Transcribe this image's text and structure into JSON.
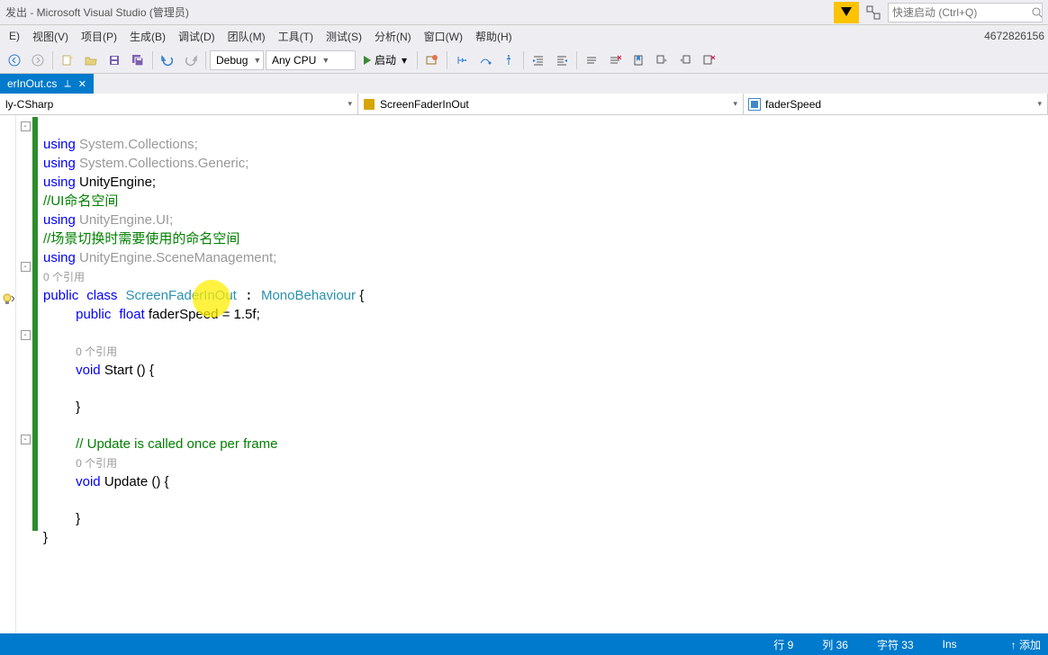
{
  "title": "发出 - Microsoft Visual Studio (管理员)",
  "quickSearch": {
    "placeholder": "快速启动 (Ctrl+Q)"
  },
  "menu": [
    "E)",
    "视图(V)",
    "项目(P)",
    "生成(B)",
    "调试(D)",
    "团队(M)",
    "工具(T)",
    "测试(S)",
    "分析(N)",
    "窗口(W)",
    "帮助(H)"
  ],
  "menuRight": "4672826156",
  "toolbar": {
    "config": "Debug",
    "platform": "Any CPU",
    "run": "启动"
  },
  "tab": {
    "name": "erInOut.cs"
  },
  "nav": {
    "ns1": "ly-CSharp",
    "ns2": "ScreenFaderInOut",
    "ns3": "faderSpeed"
  },
  "code": {
    "l1a": "using",
    "l1b": " System.Collections;",
    "l2a": "using",
    "l2b": " System.Collections.Generic;",
    "l3a": "using",
    "l3b": " UnityEngine;",
    "l4": "//UI命名空间",
    "l5a": "using",
    "l5b": " UnityEngine.UI;",
    "l6": "//场景切换时需要使用的命名空间",
    "l7a": "using",
    "l7b": " UnityEngine.SceneManagement;",
    "ref0": "0 个引用",
    "l8a": "public",
    "l8b": "class",
    "l8c": "ScreenFaderInOut",
    "l8d": "MonoBehaviour",
    "l8e": " {",
    "l9a": "public",
    "l9b": "float",
    "l9c": " faderSpeed = 1.5f;",
    "ref1": "0 个引用",
    "l10a": "void",
    "l10b": " Start () {",
    "l11": "}",
    "l12": "// Update is called once per frame",
    "ref2": "0 个引用",
    "l13a": "void",
    "l13b": " Update () {",
    "l14": "}",
    "l15": "}"
  },
  "status": {
    "line": "行 9",
    "col": "列 36",
    "char": "字符 33",
    "ins": "Ins",
    "add": "↑ 添加"
  }
}
